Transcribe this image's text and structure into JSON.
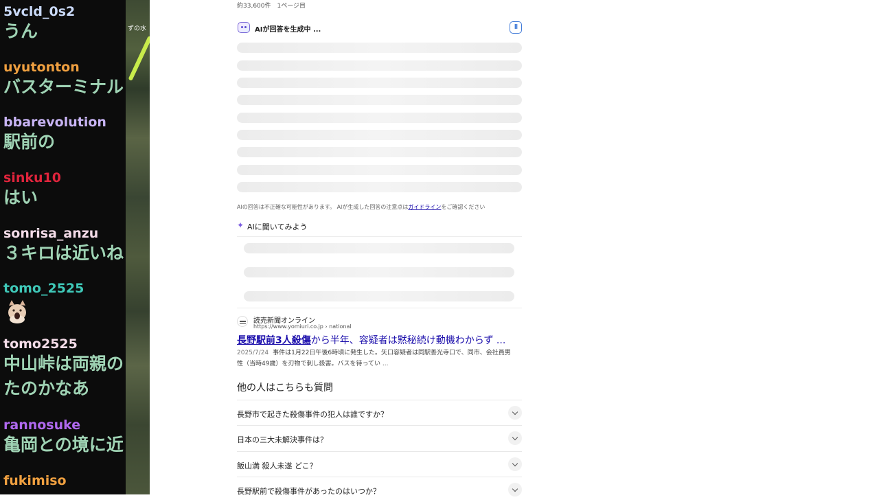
{
  "chat": {
    "messages": [
      {
        "user": "5vcld_0s2",
        "user_color": "#c9d9f7",
        "text": "うん"
      },
      {
        "user": "uyutonton",
        "user_color": "#f0a040",
        "text": "バスターミナル"
      },
      {
        "user": "bbarevolution",
        "user_color": "#c8b4f4",
        "text": "駅前の"
      },
      {
        "user": "sinku10",
        "user_color": "#e0243c",
        "text": "はい"
      },
      {
        "user": "sonrisa_anzu",
        "user_color": "#f4dce8",
        "text": "３キロは近いね"
      },
      {
        "user": "tomo_2525",
        "user_color": "#3fc8b8",
        "text": "",
        "emote": "cat-emote"
      },
      {
        "user": "tomo2525",
        "user_color": "#f4dce8",
        "text": "中山峠は両親の",
        "text2": "たのかなあ"
      },
      {
        "user": "rannosuke",
        "user_color": "#b069f0",
        "text": "亀岡との境に近"
      },
      {
        "user": "fukimiso",
        "user_color": "#f0a040",
        "text": ""
      }
    ]
  },
  "map": {
    "label": "ずの水"
  },
  "search": {
    "result_count": "約33,600件　1ページ目",
    "ai": {
      "title": "AIが回答を生成中 ...",
      "pause_icon": "pause-icon",
      "disclaimer_pre": "AIの回答は不正確な可能性があります。 AIが生成した回答の注意点は",
      "disclaimer_link": "ガイドライン",
      "disclaimer_post": "をご確認ください"
    },
    "ask": {
      "title": "AIに聞いてみよう",
      "icon": "sparkle-icon"
    },
    "result": {
      "source_name": "読売新聞オンライン",
      "source_url": "https://www.yomiuri.co.jp › national",
      "title_bold": "長野駅前3人殺傷",
      "title_rest": "から半年、容疑者は黙秘続け動機わからず ...",
      "date": "2025/7/24",
      "snippet": "事件は1月22日午後6時頃に発生した。矢口容疑者は同駅善光寺口で、同市、会社員男性（当時49歳）を刃物で刺し殺害。バスを待ってい ..."
    },
    "paa": {
      "title": "他の人はこちらも質問",
      "questions": [
        "長野市で起きた殺傷事件の犯人は誰ですか？",
        "日本の三大未解決事件は？",
        "飯山満 殺人未遂 どこ？",
        "長野駅前で殺傷事件があったのはいつか？"
      ]
    }
  }
}
